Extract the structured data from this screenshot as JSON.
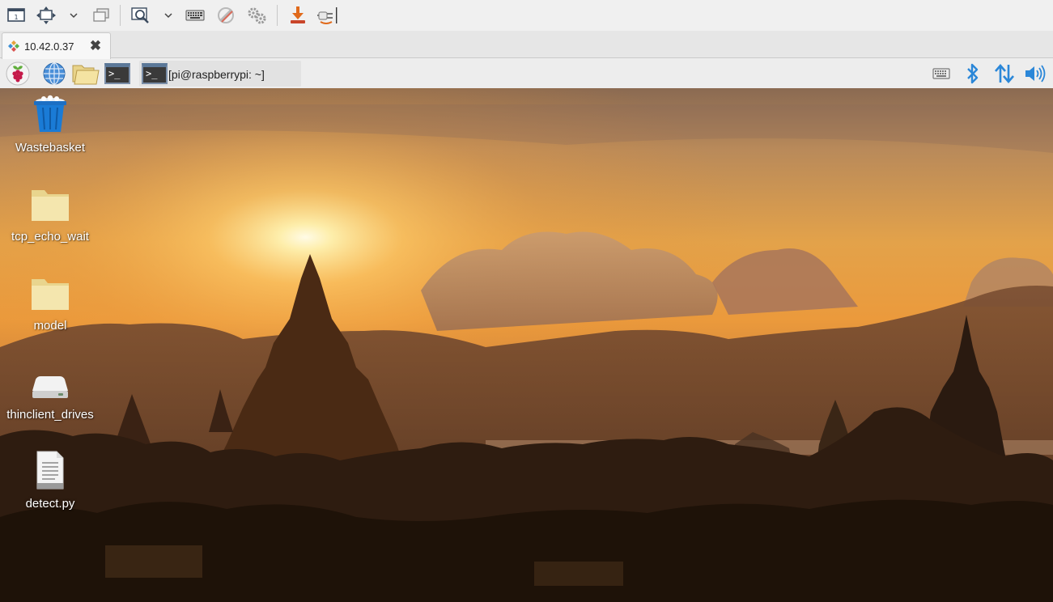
{
  "client": {
    "toolbar_icons": [
      "window-mode-icon",
      "fit-screen-icon",
      "chevron-down-icon",
      "duplicate-window-icon",
      "zoom-icon",
      "chevron-down-icon",
      "keyboard-icon",
      "tools-icon",
      "settings-icon",
      "download-icon",
      "disconnect-icon"
    ],
    "tab": {
      "label": "10.42.0.37",
      "close_glyph": "✖",
      "icon": "connection-icon"
    }
  },
  "panel": {
    "launchers": [
      "raspberry-menu-icon",
      "web-browser-icon",
      "file-manager-icon",
      "terminal-icon"
    ],
    "task": {
      "label": "[pi@raspberrypi: ~]",
      "icon": "terminal-icon"
    },
    "tray": [
      "keyboard-icon",
      "bluetooth-icon",
      "network-icon",
      "volume-icon"
    ],
    "accent": "#2b87d8"
  },
  "desktop": {
    "icons": [
      {
        "label": "Wastebasket",
        "icon": "wastebasket-icon"
      },
      {
        "label": "tcp_echo_wait",
        "icon": "folder-icon"
      },
      {
        "label": "model",
        "icon": "folder-icon"
      },
      {
        "label": "thinclient_drives",
        "icon": "drive-icon"
      },
      {
        "label": "detect.py",
        "icon": "text-file-icon"
      }
    ]
  }
}
